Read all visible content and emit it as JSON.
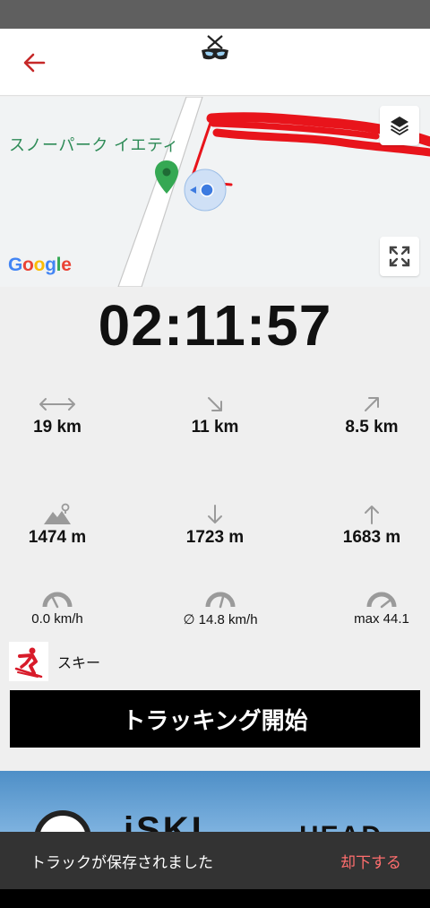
{
  "header": {
    "back_icon": "arrow-left-icon",
    "logo_icon": "crossed-skis-logo-icon",
    "accent_color": "#c62828"
  },
  "map": {
    "place_label": "スノーパーク イエティ",
    "attribution": "Google",
    "layers_icon": "layers-icon",
    "fullscreen_icon": "fullscreen-icon",
    "marker_icon": "map-pin-icon",
    "location_icon": "my-location-icon",
    "track_color": "#e8141b"
  },
  "tracking": {
    "elapsed": "02:11:57"
  },
  "stats": {
    "distance": "19 km",
    "downhill_distance": "11 km",
    "uphill_distance": "8.5 km",
    "altitude": "1474 m",
    "descent": "1723 m",
    "ascent": "1683 m",
    "current_speed": "0.0 km/h",
    "average_speed": "∅ 14.8 km/h",
    "max_speed": "max 44.1"
  },
  "sport": {
    "label": "スキー",
    "icon": "skier-icon"
  },
  "actions": {
    "start_tracking": "トラッキング開始"
  },
  "banner": {
    "brand_left": "iSKI",
    "brand_right": "HEAD"
  },
  "snackbar": {
    "message": "トラックが保存されました",
    "dismiss": "却下する"
  }
}
